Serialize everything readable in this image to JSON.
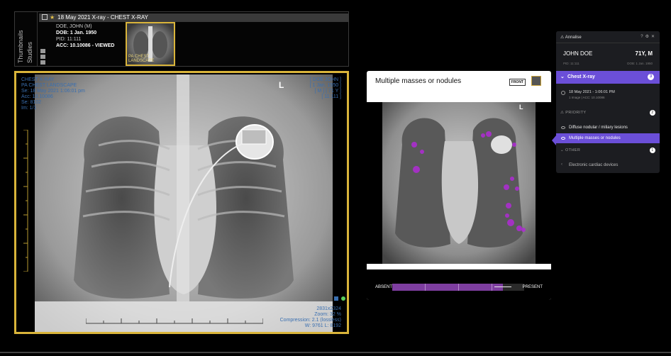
{
  "thumbnails_strip": {
    "tabs": [
      "Thumbnails",
      "Studies"
    ],
    "study_header": "18 May 2021   X-ray - CHEST X-RAY",
    "patient_lines": [
      "DOE, JOHN (M)",
      "DOB: 1 Jan. 1950",
      "PID: 11:111",
      "ACC: 10.10086 - VIEWED"
    ],
    "thumbnail_label": "PA CHEST LANDSCAPE"
  },
  "viewport": {
    "top_left": [
      "CHEST X-RAY",
      "PA CHEST LANDSCAPE",
      "Se: 18 May 2021 1:06:01 pm",
      "Acc: 10.10086",
      "Se: 8102",
      "Im: 1/1"
    ],
    "top_right": [
      "[ DOE JOHN ]",
      "[ 1 Jan. 1950 ]",
      "[ M ] [ 71 Y ]",
      "[ 11:111 ]"
    ],
    "bottom_right": [
      "2831x2324",
      "Zoom: 32 %",
      "Compression: 2.1 (lossless)",
      "W: 9761 L: 8192"
    ],
    "side_marker": "L"
  },
  "findings_panel": {
    "title": "Multiple masses or nodules",
    "view_tag": "FRONT",
    "side_marker": "L",
    "scale_absent": "ABSENT",
    "scale_present": "PRESENT",
    "score_fraction": 0.84
  },
  "sidebar": {
    "app_name": "Annalise",
    "patient_name": "JOHN DOE",
    "age_sex": "71Y, M",
    "pid_line": "PID: 11:111",
    "dob_line": "DOB: 1 Jan. 1950",
    "study": "Chest X-ray",
    "study_count": "3",
    "study_date": "18 May 2021 - 1:06:01 PM",
    "study_meta": "1 Image  |  ACC: 10.10086",
    "priority_label": "PRIORITY",
    "priority_count": "2",
    "priority_items": [
      "Diffuse nodular / miliary lesions",
      "Multiple masses or nodules"
    ],
    "other_label": "OTHER",
    "other_count": "1",
    "other_items": [
      "Electronic cardiac devices"
    ]
  },
  "colors": {
    "accent": "#6b4fd8",
    "selection_border": "#d9b43a",
    "heatmap": "#b02bd6",
    "overlay_text": "#3a6fb0"
  }
}
